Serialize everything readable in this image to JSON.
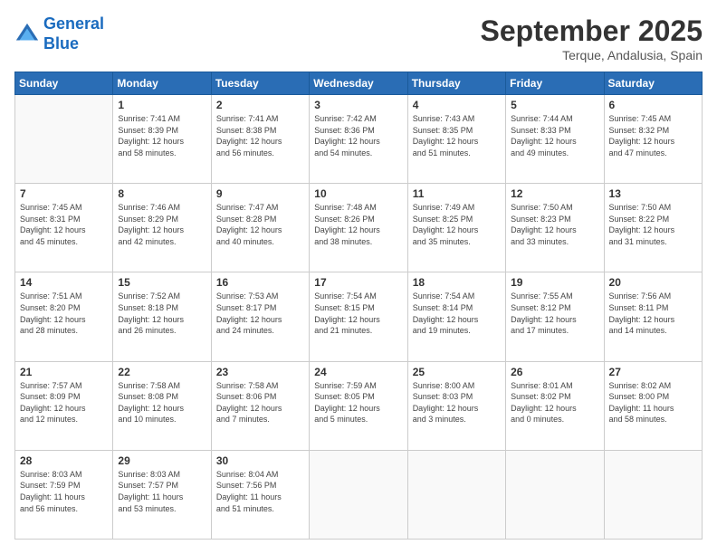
{
  "header": {
    "logo_line1": "General",
    "logo_line2": "Blue",
    "month": "September 2025",
    "location": "Terque, Andalusia, Spain"
  },
  "weekdays": [
    "Sunday",
    "Monday",
    "Tuesday",
    "Wednesday",
    "Thursday",
    "Friday",
    "Saturday"
  ],
  "weeks": [
    [
      {
        "day": "",
        "info": ""
      },
      {
        "day": "1",
        "info": "Sunrise: 7:41 AM\nSunset: 8:39 PM\nDaylight: 12 hours\nand 58 minutes."
      },
      {
        "day": "2",
        "info": "Sunrise: 7:41 AM\nSunset: 8:38 PM\nDaylight: 12 hours\nand 56 minutes."
      },
      {
        "day": "3",
        "info": "Sunrise: 7:42 AM\nSunset: 8:36 PM\nDaylight: 12 hours\nand 54 minutes."
      },
      {
        "day": "4",
        "info": "Sunrise: 7:43 AM\nSunset: 8:35 PM\nDaylight: 12 hours\nand 51 minutes."
      },
      {
        "day": "5",
        "info": "Sunrise: 7:44 AM\nSunset: 8:33 PM\nDaylight: 12 hours\nand 49 minutes."
      },
      {
        "day": "6",
        "info": "Sunrise: 7:45 AM\nSunset: 8:32 PM\nDaylight: 12 hours\nand 47 minutes."
      }
    ],
    [
      {
        "day": "7",
        "info": "Sunrise: 7:45 AM\nSunset: 8:31 PM\nDaylight: 12 hours\nand 45 minutes."
      },
      {
        "day": "8",
        "info": "Sunrise: 7:46 AM\nSunset: 8:29 PM\nDaylight: 12 hours\nand 42 minutes."
      },
      {
        "day": "9",
        "info": "Sunrise: 7:47 AM\nSunset: 8:28 PM\nDaylight: 12 hours\nand 40 minutes."
      },
      {
        "day": "10",
        "info": "Sunrise: 7:48 AM\nSunset: 8:26 PM\nDaylight: 12 hours\nand 38 minutes."
      },
      {
        "day": "11",
        "info": "Sunrise: 7:49 AM\nSunset: 8:25 PM\nDaylight: 12 hours\nand 35 minutes."
      },
      {
        "day": "12",
        "info": "Sunrise: 7:50 AM\nSunset: 8:23 PM\nDaylight: 12 hours\nand 33 minutes."
      },
      {
        "day": "13",
        "info": "Sunrise: 7:50 AM\nSunset: 8:22 PM\nDaylight: 12 hours\nand 31 minutes."
      }
    ],
    [
      {
        "day": "14",
        "info": "Sunrise: 7:51 AM\nSunset: 8:20 PM\nDaylight: 12 hours\nand 28 minutes."
      },
      {
        "day": "15",
        "info": "Sunrise: 7:52 AM\nSunset: 8:18 PM\nDaylight: 12 hours\nand 26 minutes."
      },
      {
        "day": "16",
        "info": "Sunrise: 7:53 AM\nSunset: 8:17 PM\nDaylight: 12 hours\nand 24 minutes."
      },
      {
        "day": "17",
        "info": "Sunrise: 7:54 AM\nSunset: 8:15 PM\nDaylight: 12 hours\nand 21 minutes."
      },
      {
        "day": "18",
        "info": "Sunrise: 7:54 AM\nSunset: 8:14 PM\nDaylight: 12 hours\nand 19 minutes."
      },
      {
        "day": "19",
        "info": "Sunrise: 7:55 AM\nSunset: 8:12 PM\nDaylight: 12 hours\nand 17 minutes."
      },
      {
        "day": "20",
        "info": "Sunrise: 7:56 AM\nSunset: 8:11 PM\nDaylight: 12 hours\nand 14 minutes."
      }
    ],
    [
      {
        "day": "21",
        "info": "Sunrise: 7:57 AM\nSunset: 8:09 PM\nDaylight: 12 hours\nand 12 minutes."
      },
      {
        "day": "22",
        "info": "Sunrise: 7:58 AM\nSunset: 8:08 PM\nDaylight: 12 hours\nand 10 minutes."
      },
      {
        "day": "23",
        "info": "Sunrise: 7:58 AM\nSunset: 8:06 PM\nDaylight: 12 hours\nand 7 minutes."
      },
      {
        "day": "24",
        "info": "Sunrise: 7:59 AM\nSunset: 8:05 PM\nDaylight: 12 hours\nand 5 minutes."
      },
      {
        "day": "25",
        "info": "Sunrise: 8:00 AM\nSunset: 8:03 PM\nDaylight: 12 hours\nand 3 minutes."
      },
      {
        "day": "26",
        "info": "Sunrise: 8:01 AM\nSunset: 8:02 PM\nDaylight: 12 hours\nand 0 minutes."
      },
      {
        "day": "27",
        "info": "Sunrise: 8:02 AM\nSunset: 8:00 PM\nDaylight: 11 hours\nand 58 minutes."
      }
    ],
    [
      {
        "day": "28",
        "info": "Sunrise: 8:03 AM\nSunset: 7:59 PM\nDaylight: 11 hours\nand 56 minutes."
      },
      {
        "day": "29",
        "info": "Sunrise: 8:03 AM\nSunset: 7:57 PM\nDaylight: 11 hours\nand 53 minutes."
      },
      {
        "day": "30",
        "info": "Sunrise: 8:04 AM\nSunset: 7:56 PM\nDaylight: 11 hours\nand 51 minutes."
      },
      {
        "day": "",
        "info": ""
      },
      {
        "day": "",
        "info": ""
      },
      {
        "day": "",
        "info": ""
      },
      {
        "day": "",
        "info": ""
      }
    ]
  ]
}
